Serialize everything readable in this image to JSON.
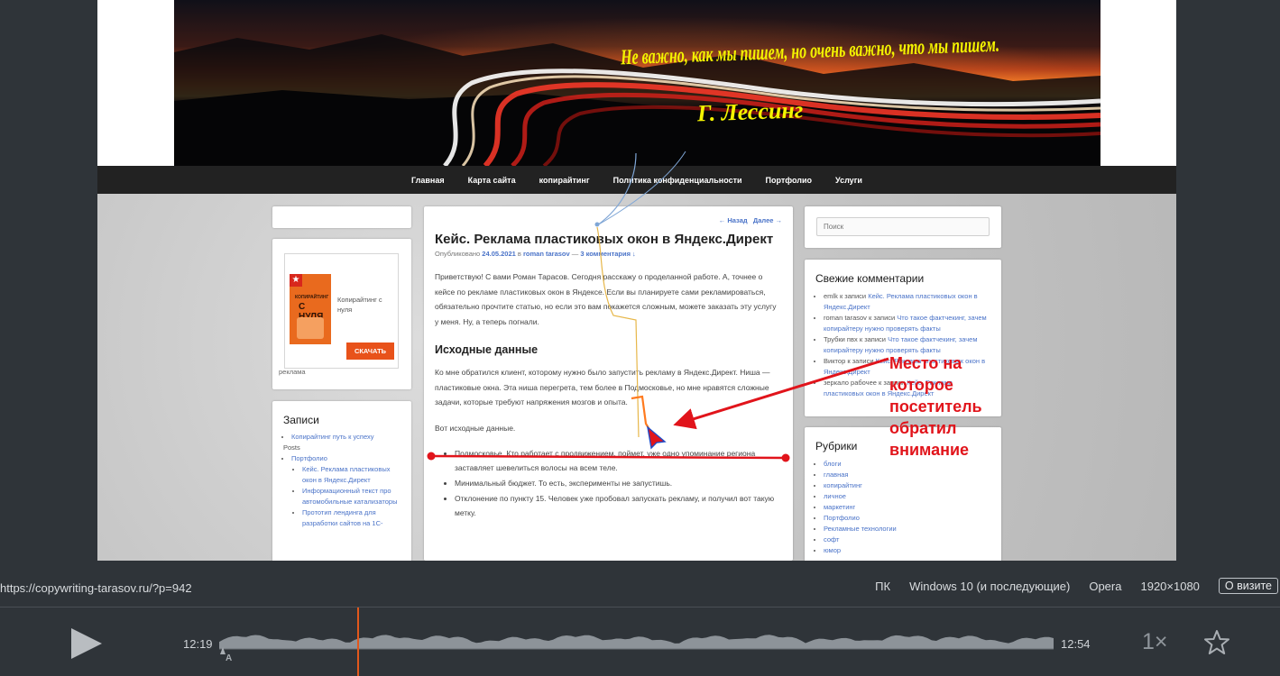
{
  "site": {
    "banner": {
      "quote": "Не важно, как мы пишем, но очень важно, что мы пишем.",
      "author": "Г. Лессинг"
    },
    "nav": [
      "Главная",
      "Карта сайта",
      "копирайтинг",
      "Политика конфиденциальности",
      "Портфолио",
      "Услуги"
    ],
    "left": {
      "ad": {
        "caption": "Копирайтинг с нуля",
        "button": "СКАЧАТЬ",
        "label": "реклама",
        "book_line1": "КОПИРАЙТИНГ",
        "book_line2": "С НУЛЯ"
      },
      "records": {
        "title": "Записи",
        "items": [
          {
            "text": "Копирайтинг путь к успеху",
            "link": true
          },
          {
            "text": "Posts",
            "link": false
          },
          {
            "text": "Портфолио",
            "link": true
          }
        ],
        "subitems": [
          "Кейс. Реклама пластиковых окон в Яндекс.Директ",
          "Информационный текст про автомобильные катализаторы",
          "Прототип лендинга для разработки сайтов на 1С-"
        ]
      }
    },
    "article": {
      "nav_prev": "← Назад",
      "nav_next": "Далее →",
      "title": "Кейс. Реклама пластиковых окон в Яндекс.Директ",
      "meta_prefix": "Опубликовано",
      "date": "24.05.2021",
      "meta_by": "в",
      "author": "roman tarasov",
      "meta_dash": "—",
      "comments": "3 комментария ↓",
      "p1": "Приветствую! С вами Роман Тарасов. Сегодня расскажу о проделанной работе. А, точнее о кейсе по рекламе пластиковых окон в Яндексе. Если вы планируете сами рекламироваться, обязательно прочтите статью, но если это вам покажется сложным, можете заказать эту услугу у меня. Ну, а теперь погнали.",
      "h2": "Исходные данные",
      "p2": "Ко мне обратился клиент, которому нужно было запустить рекламу в Яндекс.Директ. Ниша — пластиковые окна. Эта ниша перегрета, тем более в Подмосковье, но мне нравятся сложные задачи, которые требуют напряжения мозгов и опыта.",
      "p3": "Вот исходные данные.",
      "bullets": [
        "Подмосковье. Кто работает с продвижением, поймет, уже одно упоминание региона заставляет шевелиться волосы на всем теле.",
        "Минимальный бюджет. То есть, эксперименты не запустишь.",
        "Отклонение по пункту 15. Человек уже пробовал запускать рекламу, и получил вот такую метку."
      ]
    },
    "right": {
      "search_placeholder": "Поиск",
      "comments_title": "Свежие комментарии",
      "comments": [
        {
          "who": "emlk",
          "mid": "к записи",
          "post": "Кейс. Реклама пластиковых окон в Яндекс.Директ"
        },
        {
          "who": "roman tarasov",
          "mid": "к записи",
          "post": "Что такое фактчекинг, зачем копирайтеру нужно проверять факты"
        },
        {
          "who": "Трубки пвх",
          "mid": "к записи",
          "post": "Что такое фактчекинг, зачем копирайтеру нужно проверять факты"
        },
        {
          "who": "Виктор",
          "mid": "к записи",
          "post": "Кейс. Реклама пластиковых окон в Яндекс.Директ"
        },
        {
          "who": "зеркало рабочее",
          "mid": "к записи",
          "post": "Кейс. Реклама пластиковых окон в Яндекс.Директ"
        }
      ],
      "rubrics_title": "Рубрики",
      "rubrics": [
        "блоги",
        "главная",
        "копирайтинг",
        "личное",
        "маркетинг",
        "Портфолио",
        "Рекламные технологии",
        "софт",
        "юмор"
      ]
    }
  },
  "annotation": {
    "lines": [
      "Место на",
      "которое",
      "посетитель",
      "обратил",
      "внимание"
    ],
    "color": "#e1141b"
  },
  "player": {
    "url": "https://copywriting-tarasov.ru/?p=942",
    "device": "ПК",
    "os": "Windows 10 (и последующие)",
    "browser": "Opera",
    "resolution": "1920×1080",
    "visit_button": "О визите",
    "time_start": "12:19",
    "time_end": "12:54",
    "speed": "1×",
    "marker_label": "A",
    "icons": [
      "play-icon",
      "star-icon"
    ],
    "accent": "#e2581c",
    "progress": 0.166
  }
}
